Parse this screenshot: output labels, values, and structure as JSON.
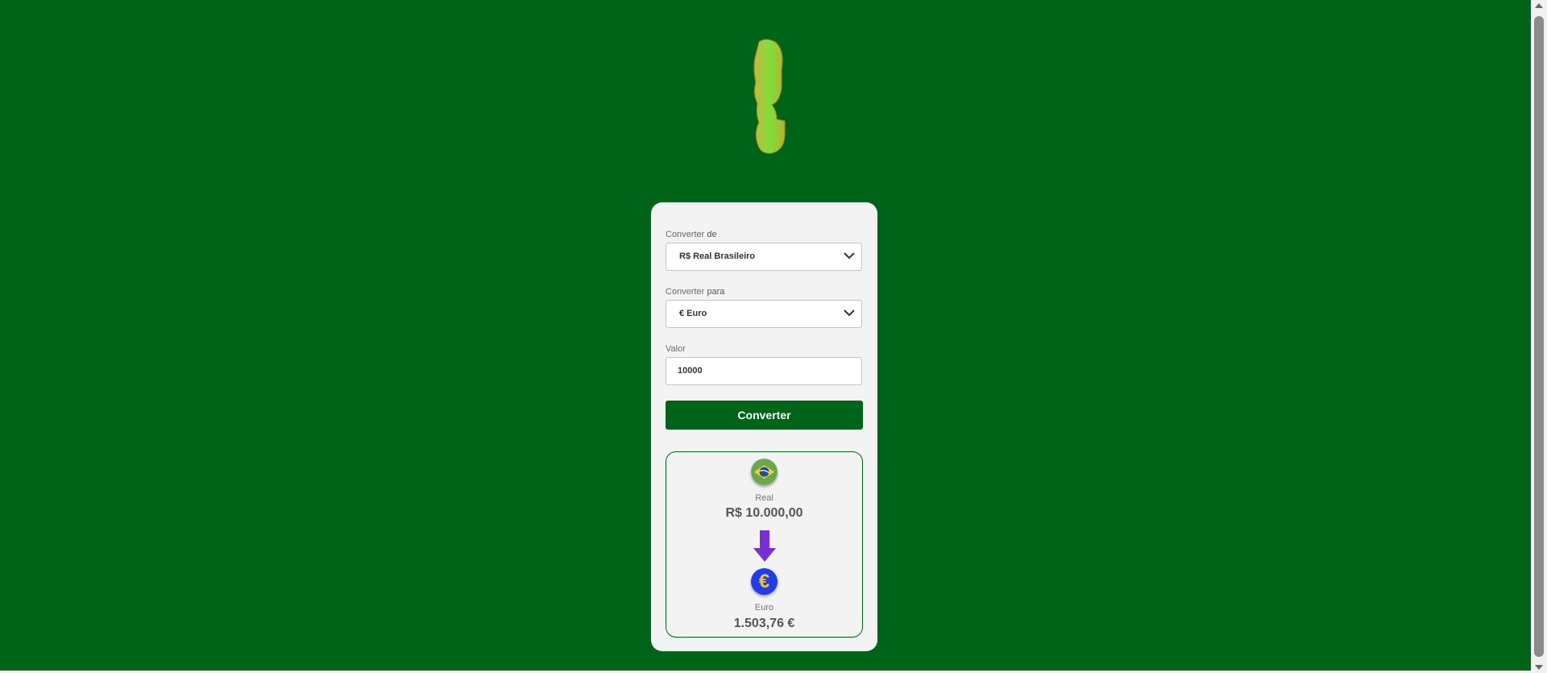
{
  "form": {
    "from_label": "Converter",
    "from_label_bold": "de",
    "from_value": "R$ Real Brasileiro",
    "to_label": "Converter",
    "to_label_bold": "para",
    "to_value": "€ Euro",
    "amount_label": "Valor",
    "amount_value": "10000",
    "submit_label": "Converter"
  },
  "result": {
    "from_name": "Real",
    "from_amount": "R$ 10.000,00",
    "to_name": "Euro",
    "to_amount": "1.503,76 €",
    "to_symbol": "€"
  },
  "colors": {
    "brand": "#006418",
    "arrow": "#7a2fd6",
    "euro_coin": "#1f3cf0",
    "euro_symbol": "#f5c518"
  }
}
